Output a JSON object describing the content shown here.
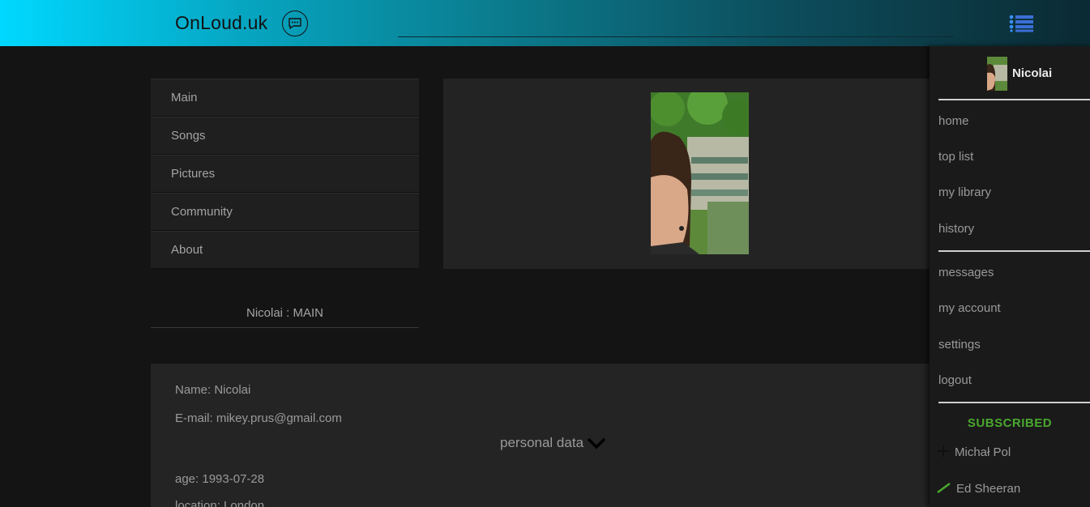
{
  "header": {
    "logo": "OnLoud.uk",
    "chat_icon": "chat-bubble-icon",
    "menu_icon": "list-icon",
    "accent_gradient": [
      "#00d8ff",
      "#0b2a33"
    ]
  },
  "leftnav": {
    "items": [
      {
        "label": "Main"
      },
      {
        "label": "Songs"
      },
      {
        "label": "Pictures"
      },
      {
        "label": "Community"
      },
      {
        "label": "About"
      }
    ],
    "profile_title": "Nicolai : MAIN"
  },
  "profile": {
    "name_line": "Name: Nicolai",
    "email_line": "E-mail: mikey.prus@gmail.com",
    "personal_data_label": "personal data",
    "age_line": "age: 1993-07-28",
    "location_line": "location: London"
  },
  "sidepanel": {
    "username": "Nicolai",
    "menu_group1": [
      {
        "label": "home"
      },
      {
        "label": "top list"
      },
      {
        "label": "my library"
      },
      {
        "label": "history"
      }
    ],
    "menu_group2": [
      {
        "label": "messages"
      },
      {
        "label": "my account"
      },
      {
        "label": "settings"
      },
      {
        "label": "logout"
      }
    ],
    "subscribed_title": "SUBSCRIBED",
    "subscribed_color": "#4aa82e",
    "subscriptions": [
      {
        "name": "Michał Pol",
        "icon": "plus-icon"
      },
      {
        "name": "Ed Sheeran",
        "icon": "check-slash-icon"
      }
    ]
  }
}
